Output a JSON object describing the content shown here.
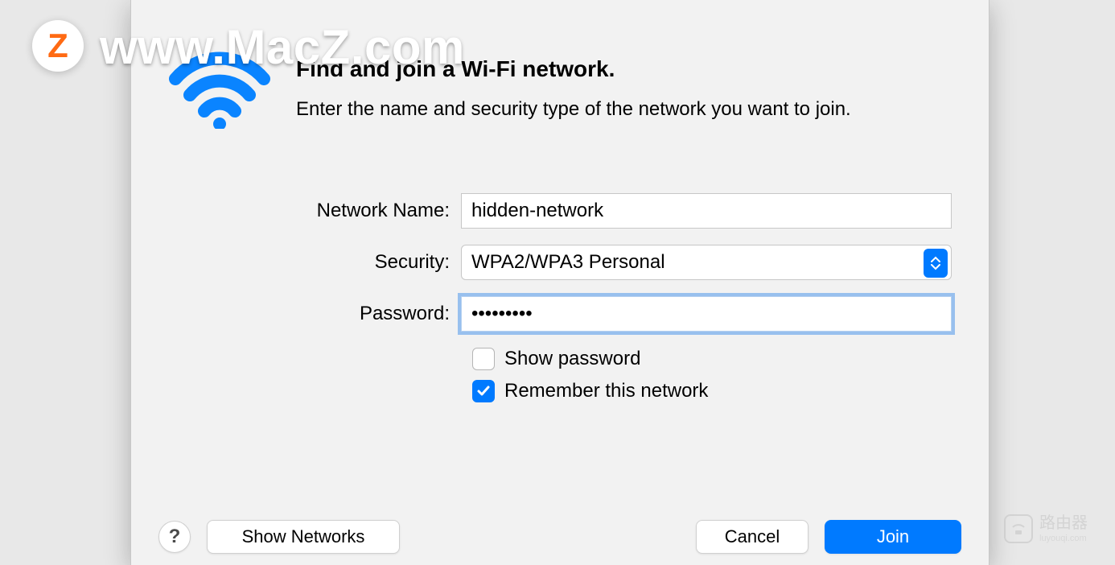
{
  "watermark": {
    "badge": "Z",
    "text": "www.MacZ.com"
  },
  "header": {
    "title": "Find and join a Wi-Fi network.",
    "subtitle": "Enter the name and security type of the network you want to join."
  },
  "form": {
    "network_name_label": "Network Name:",
    "network_name_value": "hidden-network",
    "security_label": "Security:",
    "security_value": "WPA2/WPA3 Personal",
    "password_label": "Password:",
    "password_value": "•••••••••",
    "show_password_label": "Show password",
    "show_password_checked": false,
    "remember_label": "Remember this network",
    "remember_checked": true
  },
  "buttons": {
    "help_label": "?",
    "show_networks": "Show Networks",
    "cancel": "Cancel",
    "join": "Join"
  },
  "corner_watermark": {
    "line1": "路由器",
    "line2": "luyouqi.com"
  },
  "colors": {
    "accent": "#007aff"
  }
}
